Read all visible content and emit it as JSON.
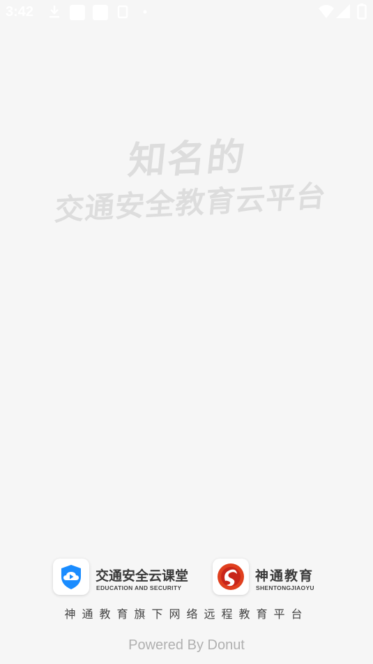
{
  "status_bar": {
    "time": "3:42",
    "icons": [
      "download-icon",
      "notification-square-icon",
      "notification-square-icon",
      "sim-icon",
      "dot-icon",
      "wifi-icon",
      "signal-icon",
      "battery-icon"
    ]
  },
  "slogan": {
    "line1": "知名的",
    "line2": "交通安全教育云平台"
  },
  "brands": [
    {
      "name": "交通安全云课堂",
      "subtitle": "EDUCATION AND SECURITY",
      "icon": "shield-cloud-play-icon",
      "color": "#1a8cff"
    },
    {
      "name": "神通教育",
      "subtitle": "SHENTONGJIAOYU",
      "icon": "shentong-swirl-logo",
      "color": "#e0401f"
    }
  ],
  "tagline": "神通教育旗下网络远程教育平台",
  "powered_by": "Powered By Donut"
}
